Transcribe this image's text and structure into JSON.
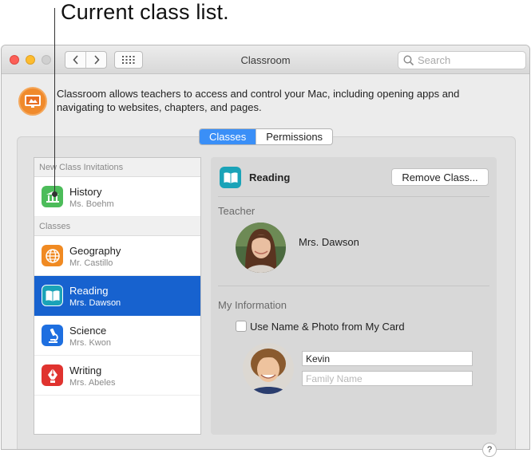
{
  "callout": {
    "text": "Current class list."
  },
  "window": {
    "title": "Classroom",
    "search_placeholder": "Search"
  },
  "header": {
    "description": "Classroom allows teachers to access and control your Mac, including opening apps and navigating to websites, chapters, and pages."
  },
  "tabs": [
    {
      "label": "Classes",
      "active": true
    },
    {
      "label": "Permissions",
      "active": false
    }
  ],
  "sidebar": {
    "invitations_header": "New Class Invitations",
    "invitations": [
      {
        "name": "History",
        "teacher": "Ms. Boehm",
        "icon": "museum-icon",
        "color": "#4cbc5a"
      }
    ],
    "classes_header": "Classes",
    "classes": [
      {
        "name": "Geography",
        "teacher": "Mr. Castillo",
        "icon": "globe-icon",
        "color": "#f08a22"
      },
      {
        "name": "Reading",
        "teacher": "Mrs. Dawson",
        "icon": "book-icon",
        "color": "#1aa3b8",
        "selected": true
      },
      {
        "name": "Science",
        "teacher": "Mrs. Kwon",
        "icon": "microscope-icon",
        "color": "#1e6fe0"
      },
      {
        "name": "Writing",
        "teacher": "Mrs. Abeles",
        "icon": "pen-nib-icon",
        "color": "#e0332f"
      }
    ]
  },
  "detail": {
    "class_name": "Reading",
    "remove_button": "Remove Class...",
    "teacher_header": "Teacher",
    "teacher_name": "Mrs. Dawson",
    "my_info_header": "My Information",
    "use_card_label": "Use Name & Photo from My Card",
    "use_card_checked": false,
    "first_name_value": "Kevin",
    "family_name_placeholder": "Family Name"
  },
  "help_label": "?",
  "colors": {
    "accent": "#3a8ff7",
    "selection": "#1762cf"
  }
}
